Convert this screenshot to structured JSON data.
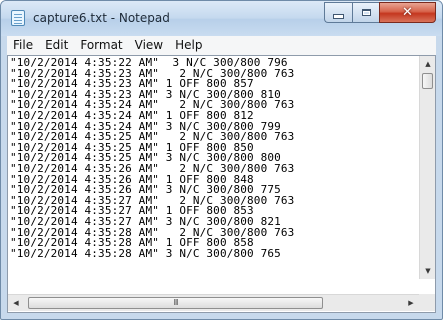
{
  "window": {
    "title": "capture6.txt - Notepad"
  },
  "menu": [
    "File",
    "Edit",
    "Format",
    "View",
    "Help"
  ],
  "lines": [
    "\"10/2/2014 4:35:22 AM\"  3 N/C 300/800 796",
    "\"10/2/2014 4:35:23 AM\"   2 N/C 300/800 763",
    "\"10/2/2014 4:35:23 AM\" 1 OFF 800 857",
    "\"10/2/2014 4:35:23 AM\" 3 N/C 300/800 810",
    "\"10/2/2014 4:35:24 AM\"   2 N/C 300/800 763",
    "\"10/2/2014 4:35:24 AM\" 1 OFF 800 812",
    "\"10/2/2014 4:35:24 AM\" 3 N/C 300/800 799",
    "\"10/2/2014 4:35:25 AM\"   2 N/C 300/800 763",
    "\"10/2/2014 4:35:25 AM\" 1 OFF 800 850",
    "\"10/2/2014 4:35:25 AM\" 3 N/C 300/800 800",
    "\"10/2/2014 4:35:26 AM\"   2 N/C 300/800 763",
    "\"10/2/2014 4:35:26 AM\" 1 OFF 800 848",
    "\"10/2/2014 4:35:26 AM\" 3 N/C 300/800 775",
    "\"10/2/2014 4:35:27 AM\"   2 N/C 300/800 763",
    "\"10/2/2014 4:35:27 AM\" 1 OFF 800 853",
    "\"10/2/2014 4:35:27 AM\" 3 N/C 300/800 821",
    "\"10/2/2014 4:35:28 AM\"   2 N/C 300/800 763",
    "\"10/2/2014 4:35:28 AM\" 1 OFF 800 858",
    "\"10/2/2014 4:35:28 AM\" 3 N/C 300/800 765"
  ],
  "scrollbar": {
    "grip": "III"
  },
  "icons": {
    "app": "notepad-icon",
    "minimize": "minimize-icon",
    "maximize": "maximize-icon",
    "close": "close-icon"
  },
  "colors": {
    "frame": "#c7d9ec",
    "close_button": "#c4371f",
    "menubar": "#f5f6f7"
  }
}
